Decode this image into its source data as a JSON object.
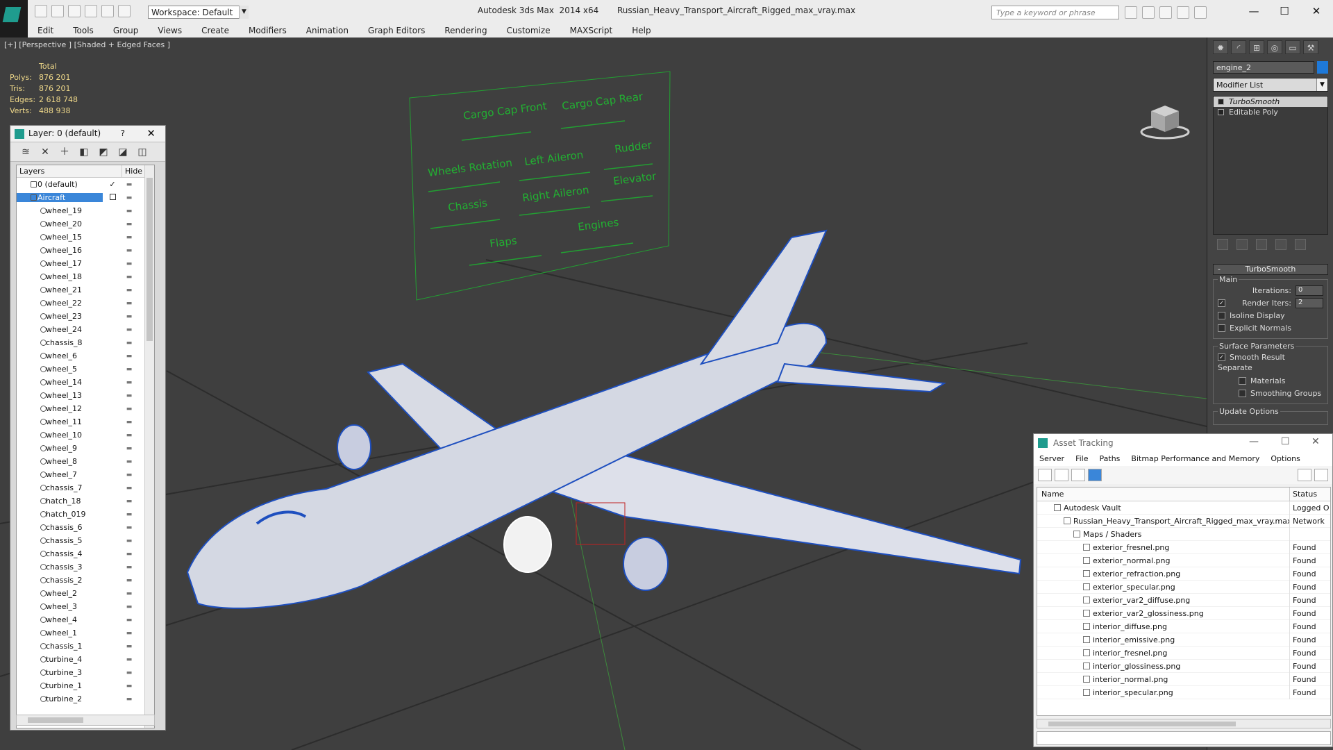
{
  "titlebar": {
    "app_title": "Autodesk 3ds Max  2014 x64       Russian_Heavy_Transport_Aircraft_Rigged_max_vray.max",
    "workspace": "Workspace: Default",
    "search_placeholder": "Type a keyword or phrase",
    "minimize": "—",
    "maximize": "☐",
    "close": "✕"
  },
  "menu": [
    "Edit",
    "Tools",
    "Group",
    "Views",
    "Create",
    "Modifiers",
    "Animation",
    "Graph Editors",
    "Rendering",
    "Customize",
    "MAXScript",
    "Help"
  ],
  "viewport": {
    "label": "[+] [Perspective ] [Shaded + Edged Faces ]",
    "stats": {
      "header": "Total",
      "rows": [
        {
          "key": "Polys:",
          "value": "876 201"
        },
        {
          "key": "Tris:",
          "value": "876 201"
        },
        {
          "key": "Edges:",
          "value": "2 618 748"
        },
        {
          "key": "Verts:",
          "value": "488 938"
        }
      ]
    },
    "rig_labels": [
      "Cargo Cap Front",
      "Cargo Cap Rear",
      "Wheels Rotation",
      "Left Aileron",
      "Rudder",
      "Chassis",
      "Right Aileron",
      "Elevator",
      "Flaps",
      "Engines"
    ]
  },
  "layer_panel": {
    "title": "Layer: 0 (default)",
    "help": "?",
    "close": "✕",
    "col_layers": "Layers",
    "col_hide": "Hide",
    "check": "✓",
    "layers": [
      {
        "name": "0 (default)",
        "type": "layer"
      },
      {
        "name": "Aircraft",
        "type": "layer"
      },
      {
        "name": "wheel_19"
      },
      {
        "name": "wheel_20"
      },
      {
        "name": "wheel_15"
      },
      {
        "name": "wheel_16"
      },
      {
        "name": "wheel_17"
      },
      {
        "name": "wheel_18"
      },
      {
        "name": "wheel_21"
      },
      {
        "name": "wheel_22"
      },
      {
        "name": "wheel_23"
      },
      {
        "name": "wheel_24"
      },
      {
        "name": "chassis_8"
      },
      {
        "name": "wheel_6"
      },
      {
        "name": "wheel_5"
      },
      {
        "name": "wheel_14"
      },
      {
        "name": "wheel_13"
      },
      {
        "name": "wheel_12"
      },
      {
        "name": "wheel_11"
      },
      {
        "name": "wheel_10"
      },
      {
        "name": "wheel_9"
      },
      {
        "name": "wheel_8"
      },
      {
        "name": "wheel_7"
      },
      {
        "name": "chassis_7"
      },
      {
        "name": "hatch_18"
      },
      {
        "name": "hatch_019"
      },
      {
        "name": "chassis_6"
      },
      {
        "name": "chassis_5"
      },
      {
        "name": "chassis_4"
      },
      {
        "name": "chassis_3"
      },
      {
        "name": "chassis_2"
      },
      {
        "name": "wheel_2"
      },
      {
        "name": "wheel_3"
      },
      {
        "name": "wheel_4"
      },
      {
        "name": "wheel_1"
      },
      {
        "name": "chassis_1"
      },
      {
        "name": "turbine_4"
      },
      {
        "name": "turbine_3"
      },
      {
        "name": "turbine_1"
      },
      {
        "name": "turbine_2"
      }
    ]
  },
  "command_panel": {
    "object_name": "engine_2",
    "object_color": "#1e79d9",
    "modifier_list": "Modifier List",
    "stack": [
      "TurboSmooth",
      "Editable Poly"
    ],
    "rollout_title": "TurboSmooth",
    "main_group": "Main",
    "iterations_label": "Iterations:",
    "iterations_value": "0",
    "render_iters_label": "Render Iters:",
    "render_iters_value": "2",
    "isoline": "Isoline Display",
    "explicit_normals": "Explicit Normals",
    "surface_group": "Surface Parameters",
    "smooth_result": "Smooth Result",
    "separate": "Separate",
    "materials": "Materials",
    "smoothing_groups": "Smoothing Groups",
    "update_options": "Update Options"
  },
  "asset_tracking": {
    "title": "Asset Tracking",
    "menu": [
      "Server",
      "File",
      "Paths",
      "Bitmap Performance and Memory",
      "Options"
    ],
    "col_name": "Name",
    "col_status": "Status",
    "rows": [
      {
        "name": "Autodesk Vault",
        "status": "Logged O",
        "indent": 1
      },
      {
        "name": "Russian_Heavy_Transport_Aircraft_Rigged_max_vray.max",
        "status": "Network",
        "indent": 2
      },
      {
        "name": "Maps / Shaders",
        "status": "",
        "indent": 3
      },
      {
        "name": "exterior_fresnel.png",
        "status": "Found",
        "indent": 4
      },
      {
        "name": "exterior_normal.png",
        "status": "Found",
        "indent": 4
      },
      {
        "name": "exterior_refraction.png",
        "status": "Found",
        "indent": 4
      },
      {
        "name": "exterior_specular.png",
        "status": "Found",
        "indent": 4
      },
      {
        "name": "exterior_var2_diffuse.png",
        "status": "Found",
        "indent": 4
      },
      {
        "name": "exterior_var2_glossiness.png",
        "status": "Found",
        "indent": 4
      },
      {
        "name": "interior_diffuse.png",
        "status": "Found",
        "indent": 4
      },
      {
        "name": "interior_emissive.png",
        "status": "Found",
        "indent": 4
      },
      {
        "name": "interior_fresnel.png",
        "status": "Found",
        "indent": 4
      },
      {
        "name": "interior_glossiness.png",
        "status": "Found",
        "indent": 4
      },
      {
        "name": "interior_normal.png",
        "status": "Found",
        "indent": 4
      },
      {
        "name": "interior_specular.png",
        "status": "Found",
        "indent": 4
      }
    ]
  }
}
